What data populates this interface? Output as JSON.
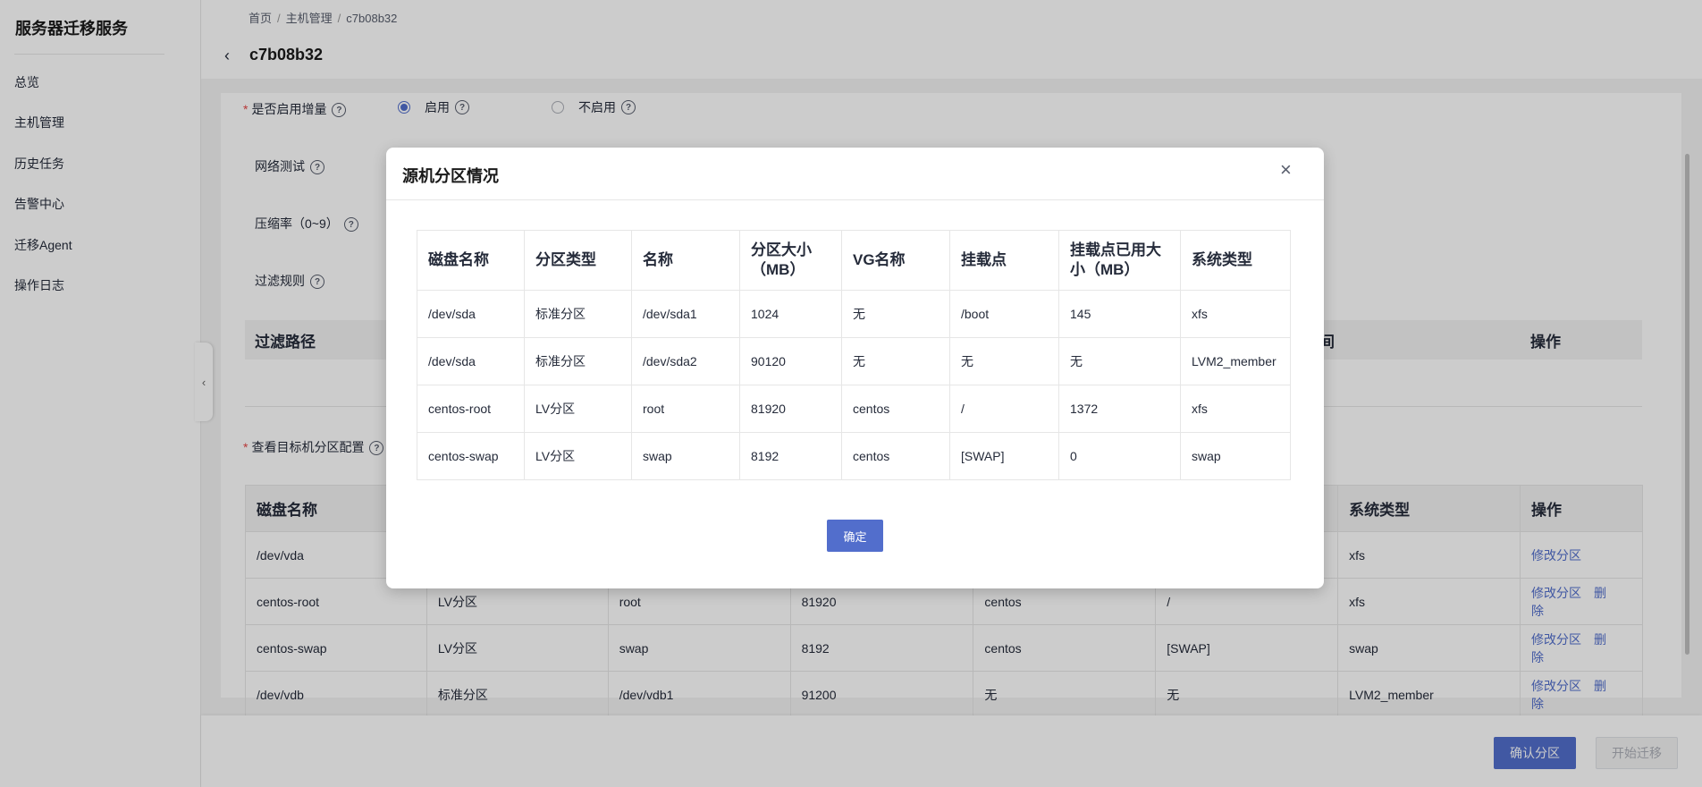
{
  "sidebar": {
    "title": "服务器迁移服务",
    "items": [
      {
        "label": "总览"
      },
      {
        "label": "主机管理"
      },
      {
        "label": "历史任务"
      },
      {
        "label": "告警中心"
      },
      {
        "label": "迁移Agent"
      },
      {
        "label": "操作日志"
      }
    ],
    "collapse_icon": "‹"
  },
  "header": {
    "breadcrumb": [
      "首页",
      "主机管理",
      "c7b08b32"
    ],
    "breadcrumb_sep": "/",
    "back_icon": "‹",
    "title": "c7b08b32"
  },
  "form": {
    "incremental_label": "是否启用增量",
    "required_mark": "*",
    "help_icon": "?",
    "radio_enable": "启用",
    "radio_disable": "不启用",
    "network_test_label": "网络测试",
    "compress_label": "压缩率（0~9）",
    "filter_rule_label": "过滤规则",
    "filter_table": {
      "col_path": "过滤路径",
      "col_time": "间",
      "col_op": "操作"
    },
    "target_partition_label": "查看目标机分区配置"
  },
  "target_table": {
    "headers": [
      "磁盘名称",
      "",
      "",
      "",
      "",
      "",
      "系统类型",
      "操作"
    ],
    "rows": [
      {
        "cells": [
          "/dev/vda",
          "",
          "",
          "",
          "",
          "",
          "xfs"
        ],
        "ops": [
          "修改分区"
        ]
      },
      {
        "cells": [
          "centos-root",
          "LV分区",
          "root",
          "81920",
          "centos",
          "/",
          "xfs"
        ],
        "ops": [
          "修改分区",
          "删除"
        ]
      },
      {
        "cells": [
          "centos-swap",
          "LV分区",
          "swap",
          "8192",
          "centos",
          "[SWAP]",
          "swap"
        ],
        "ops": [
          "修改分区",
          "删除"
        ]
      },
      {
        "cells": [
          "/dev/vdb",
          "标准分区",
          "/dev/vdb1",
          "91200",
          "无",
          "无",
          "LVM2_member"
        ],
        "ops": [
          "修改分区",
          "删除"
        ]
      }
    ]
  },
  "footer": {
    "confirm_partition": "确认分区",
    "start_migrate": "开始迁移"
  },
  "modal": {
    "title": "源机分区情况",
    "close_icon": "×",
    "ok_button": "确定",
    "headers": [
      "磁盘名称",
      "分区类型",
      "名称",
      "分区大小（MB）",
      "VG名称",
      "挂载点",
      "挂载点已用大小（MB）",
      "系统类型"
    ],
    "rows": [
      [
        "/dev/sda",
        "标准分区",
        "/dev/sda1",
        "1024",
        "无",
        "/boot",
        "145",
        "xfs"
      ],
      [
        "/dev/sda",
        "标准分区",
        "/dev/sda2",
        "90120",
        "无",
        "无",
        "无",
        "LVM2_member"
      ],
      [
        "centos-root",
        "LV分区",
        "root",
        "81920",
        "centos",
        "/",
        "1372",
        "xfs"
      ],
      [
        "centos-swap",
        "LV分区",
        "swap",
        "8192",
        "centos",
        "[SWAP]",
        "0",
        "swap"
      ]
    ]
  }
}
